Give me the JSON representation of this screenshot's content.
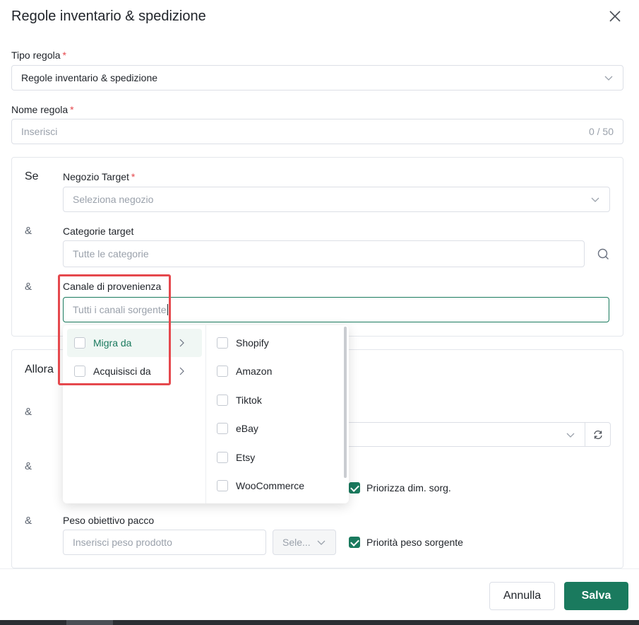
{
  "dialog": {
    "title": "Regole inventario & spedizione"
  },
  "rule_type": {
    "label": "Tipo regola",
    "required": "*",
    "value": "Regole inventario & spedizione"
  },
  "rule_name": {
    "label": "Nome regola",
    "required": "*",
    "placeholder": "Inserisci",
    "counter": "0 / 50"
  },
  "condition": {
    "if_label": "Se",
    "and_label": "&",
    "target_store": {
      "label": "Negozio Target",
      "required": "*",
      "placeholder": "Seleziona negozio"
    },
    "target_categories": {
      "label": "Categorie target",
      "placeholder": "Tutte le categorie"
    },
    "source_channel": {
      "label": "Canale di provenienza",
      "placeholder": "Tutti i canali sorgente"
    }
  },
  "action": {
    "then_label": "Allora",
    "prioritize_dim": "Priorizza dim. sorg.",
    "target_weight": {
      "label": "Peso obiettivo pacco",
      "placeholder": "Inserisci peso prodotto",
      "unit_placeholder": "Sele...",
      "priority_label": "Priorità peso sorgente"
    }
  },
  "dropdown": {
    "left_options": [
      {
        "label": "Migra da",
        "active": true
      },
      {
        "label": "Acquisisci da",
        "active": false
      }
    ],
    "right_options": [
      "Shopify",
      "Amazon",
      "Tiktok",
      "eBay",
      "Etsy",
      "WooCommerce"
    ]
  },
  "footer": {
    "cancel": "Annulla",
    "save": "Salva"
  },
  "colors": {
    "accent": "#1a7a5e",
    "required": "#e5484d",
    "highlight_box": "#e5484d"
  }
}
